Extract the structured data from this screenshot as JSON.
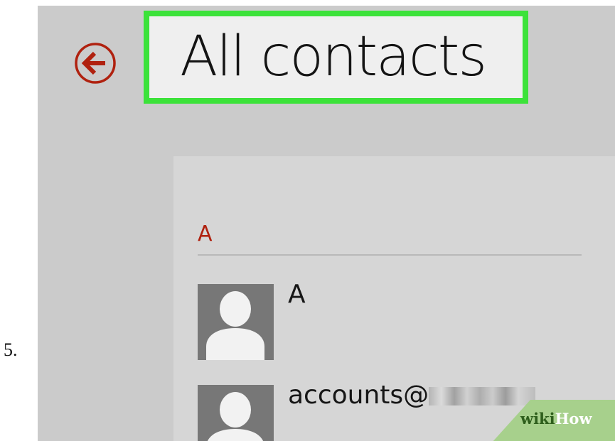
{
  "step": {
    "number": "5."
  },
  "header": {
    "back_icon": "arrow-left-circle-icon",
    "title": "All contacts",
    "highlight_color": "#3ce23a",
    "accent_color": "#b0210f"
  },
  "contacts": {
    "group_letter": "A",
    "rows": [
      {
        "name": "A",
        "avatar_icon": "person-placeholder-icon",
        "obscured": false
      },
      {
        "name": "accounts@",
        "avatar_icon": "person-placeholder-icon",
        "obscured": true
      }
    ]
  },
  "watermark": {
    "part1": "wiki",
    "part2": "How"
  }
}
